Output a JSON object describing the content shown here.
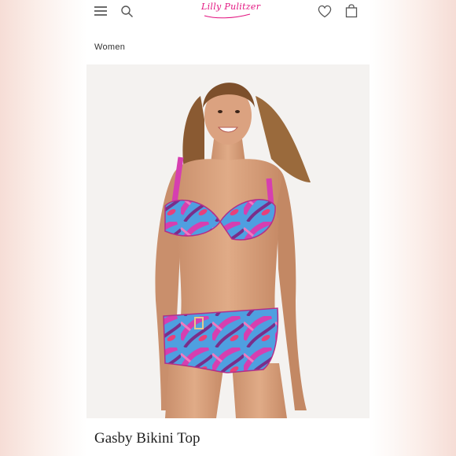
{
  "header": {
    "menu_icon": "hamburger-menu-icon",
    "search_icon": "search-icon",
    "logo_text": "Lilly Pulitzer",
    "wishlist_icon": "heart-icon",
    "bag_icon": "shopping-bag-icon",
    "brand_color": "#e2137f"
  },
  "breadcrumb": {
    "label": "Women"
  },
  "product": {
    "title": "Gasby Bikini Top",
    "print_colors": [
      "#d63fb0",
      "#4f9fe0",
      "#7a2e8a",
      "#e8407a"
    ]
  }
}
